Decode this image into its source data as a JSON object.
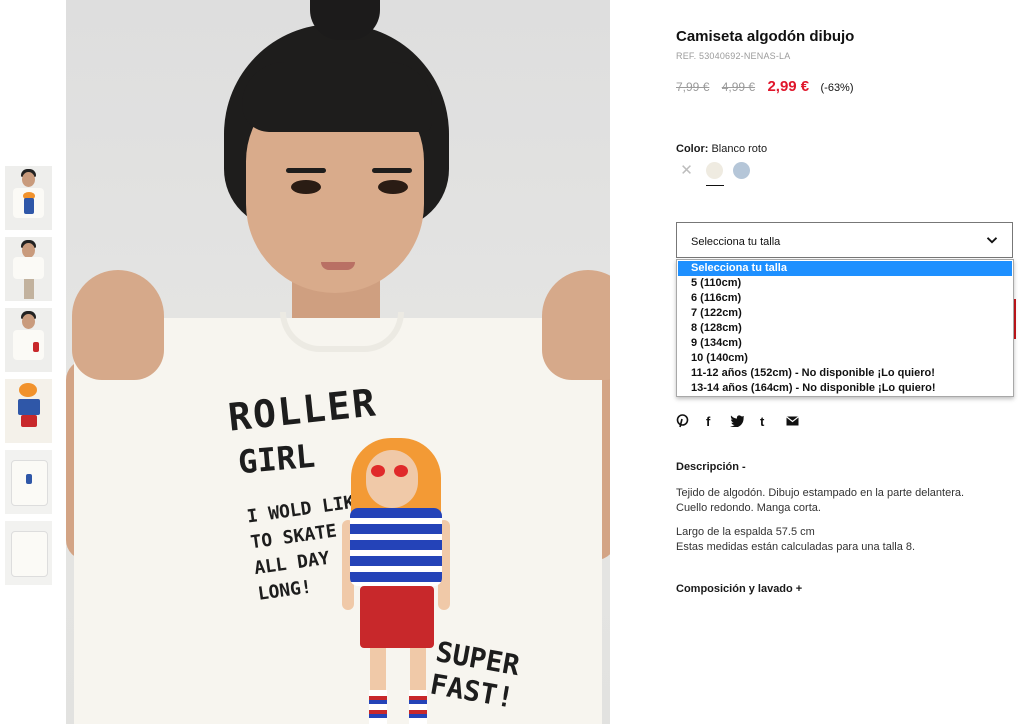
{
  "product": {
    "title": "Camiseta algodón dibujo",
    "ref": "REF. 53040692-NENAS-LA",
    "price_original": "7,99 €",
    "price_previous": "4,99 €",
    "price_sale": "2,99 €",
    "discount": "(-63%)",
    "sale_color": "#e0162b"
  },
  "color": {
    "label": "Color:",
    "value": "Blanco roto",
    "swatches": [
      {
        "name": "unavailable",
        "icon": "close-icon",
        "symbol": "✕",
        "hex": "#bdbdbd"
      },
      {
        "name": "Blanco roto",
        "hex": "#efebe1",
        "selected": true
      },
      {
        "name": "azul",
        "hex": "#b5c6d8"
      }
    ]
  },
  "size": {
    "placeholder": "Selecciona tu talla",
    "options": [
      "Selecciona tu talla",
      "5 (110cm)",
      "6 (116cm)",
      "7 (122cm)",
      "8 (128cm)",
      "9 (134cm)",
      "10 (140cm)",
      "11-12 años (152cm) - No disponible ¡Lo quiero!",
      "13-14 años (164cm) - No disponible ¡Lo quiero!"
    ],
    "highlight_color": "#1e90ff"
  },
  "share": {
    "icons": [
      {
        "icon": "pinterest-icon",
        "glyph": "℗"
      },
      {
        "icon": "facebook-icon",
        "glyph": "f"
      },
      {
        "icon": "twitter-icon",
        "glyph": "🐦"
      },
      {
        "icon": "tumblr-icon",
        "glyph": "t"
      },
      {
        "icon": "email-icon",
        "glyph": "✉"
      }
    ]
  },
  "description": {
    "heading": "Descripción  -",
    "line1": "Tejido de algodón. Dibujo estampado en la parte delantera.",
    "line2": "Cuello redondo. Manga corta.",
    "line3": "Largo de la espalda 57.5 cm",
    "line4": "Estas medidas están calculadas para una talla 8."
  },
  "composition": {
    "heading": "Composición y lavado  +"
  },
  "image_print": {
    "text1": "ROLLER",
    "text2": "GIRL",
    "text3": "I WOLD LIKE TO SKATE ALL DAY LONG!",
    "text4": "SUPER FAST!"
  }
}
